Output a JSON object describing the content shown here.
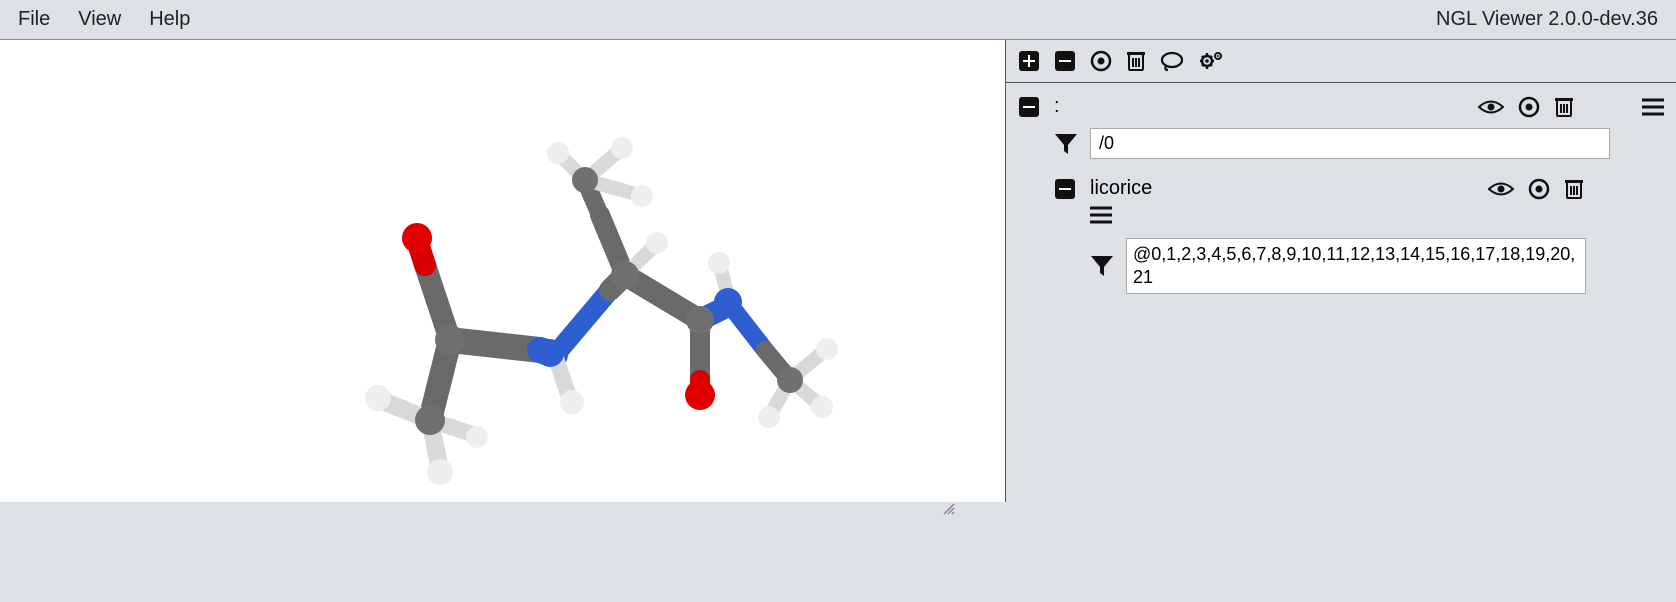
{
  "menubar": {
    "file": "File",
    "view": "View",
    "help": "Help",
    "version": "NGL Viewer 2.0.0-dev.36"
  },
  "sidebar": {
    "component": {
      "label": ":",
      "filter": "/0"
    },
    "representation": {
      "label": "licorice",
      "filter": "@0,1,2,3,4,5,6,7,8,9,10,11,12,13,14,15,16,17,18,19,20,21"
    }
  }
}
